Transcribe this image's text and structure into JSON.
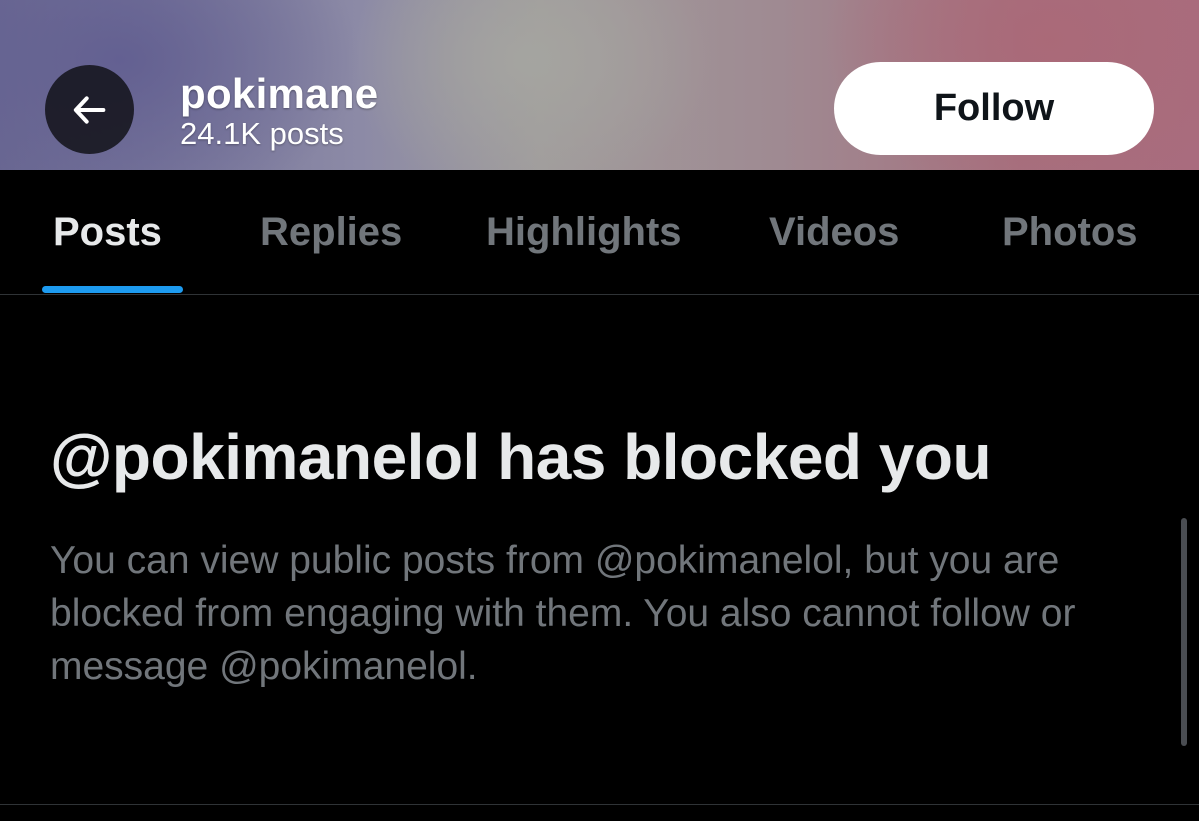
{
  "header": {
    "back_icon": "arrow-left-icon",
    "name": "pokimane",
    "post_count": "24.1K posts",
    "follow_label": "Follow"
  },
  "tabs": [
    {
      "label": "Posts",
      "active": true
    },
    {
      "label": "Replies",
      "active": false
    },
    {
      "label": "Highlights",
      "active": false
    },
    {
      "label": "Videos",
      "active": false
    },
    {
      "label": "Photos",
      "active": false
    }
  ],
  "blocked": {
    "title": "@pokimanelol has blocked you",
    "body": "You can view public posts from @pokimanelol, but you are blocked from engaging with them. You also cannot follow or message @pokimanelol."
  },
  "colors": {
    "accent": "#1d9bf0",
    "background": "#000000",
    "text_primary": "#e7e9ea",
    "text_secondary": "#71767b",
    "follow_button": "#ffffff"
  }
}
